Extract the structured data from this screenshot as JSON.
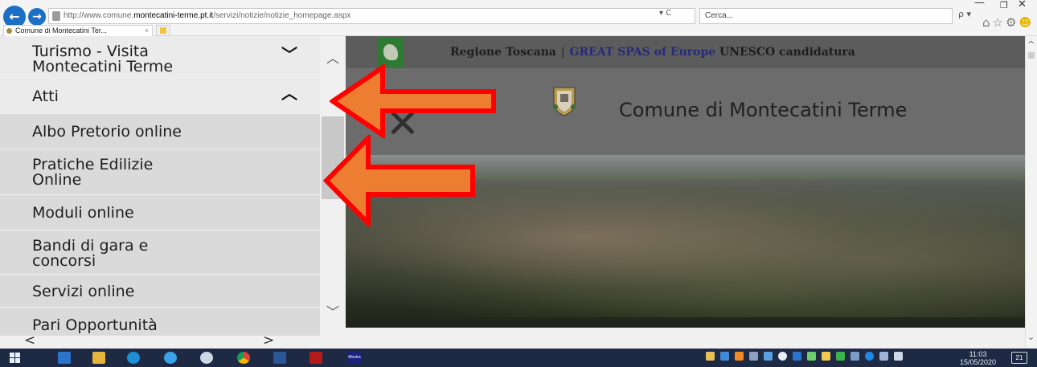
{
  "browser": {
    "url_prefix": "http://www.comune.",
    "url_host": "montecatini-terme.pt.it",
    "url_path": "/servizi/notizie/notizie_homepage.aspx",
    "address_tools": "▾ C",
    "search_placeholder": "Cerca...",
    "search_tools": "ρ ▾",
    "tab_title": "Comune di Montecatini Ter...",
    "tab_close": "×",
    "window_min": "—",
    "window_max": "❐",
    "window_close": "✕"
  },
  "sidebar": {
    "items": [
      {
        "label_line1": "Turismo - Visita",
        "label_line2": "Montecatini Terme",
        "chevron": "﹀",
        "icon": "chevron-down-icon"
      },
      {
        "label_line1": "Atti",
        "chevron": "︿",
        "icon": "chevron-up-icon"
      },
      {
        "label_line1": "Albo Pretorio online"
      },
      {
        "label_line1": "Pratiche Edilizie",
        "label_line2": "Online"
      },
      {
        "label_line1": "Moduli online"
      },
      {
        "label_line1": "Bandi di gara e",
        "label_line2": "concorsi"
      },
      {
        "label_line1": "Servizi online"
      },
      {
        "label_line1": "Pari Opportunità"
      }
    ],
    "scroll_up": "︿",
    "scroll_down": "﹀",
    "hscroll_left": "<",
    "hscroll_right": ">"
  },
  "header": {
    "region": "Regione Toscana",
    "separator": "|",
    "great_spas": "GREAT SPAS of Europe",
    "unesco": "UNESCO candidatura",
    "close_symbol": "✕",
    "site_title": "Comune di Montecatini Terme"
  },
  "page_scroll": {
    "up": "^",
    "down": "⌄"
  },
  "taskbar": {
    "time": "11:03",
    "date": "15/05/2020",
    "notification_count": "21",
    "app_label_mostra": "Mostra"
  },
  "colors": {
    "arrow_fill": "#ed7d31",
    "arrow_stroke": "#ff0000",
    "taskbar_bg": "#1e2a44",
    "sidebar_bg": "#dadada",
    "brand_blue": "#262a7a"
  }
}
